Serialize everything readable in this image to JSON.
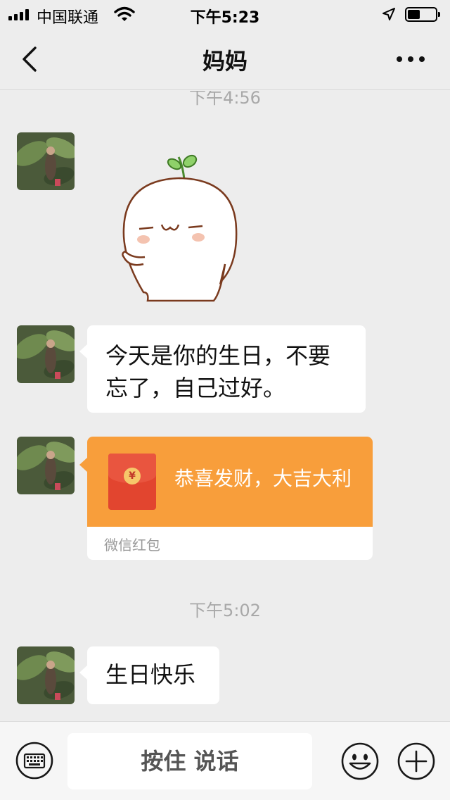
{
  "status_bar": {
    "carrier": "中国联通",
    "time": "下午5:23",
    "battery_level": 0.45
  },
  "nav": {
    "title": "妈妈"
  },
  "messages": {
    "timestamp_1": "下午4:56",
    "text_1": "今天是你的生日，不要忘了，自己过好。",
    "red_packet": {
      "greeting": "恭喜发财，大吉大利",
      "label": "微信红包",
      "coin_symbol": "¥"
    },
    "timestamp_2": "下午5:02",
    "text_2": "生日快乐"
  },
  "input_bar": {
    "hold_to_talk": "按住 说话"
  },
  "colors": {
    "background": "#ededed",
    "red_packet": "#f89e3b",
    "envelope": "#e2452f"
  }
}
